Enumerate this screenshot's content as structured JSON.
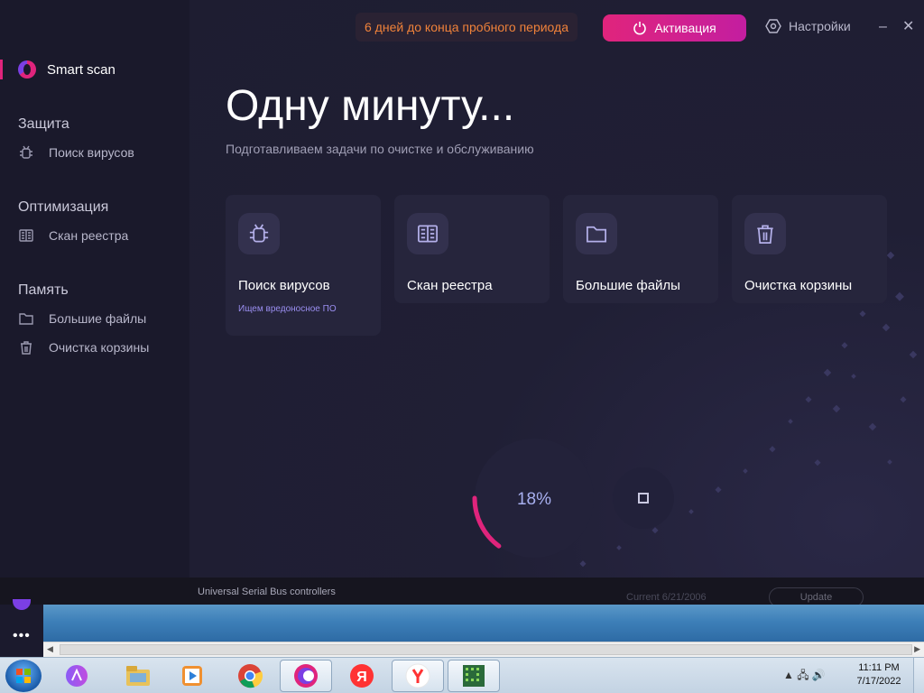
{
  "sidebar": {
    "smart_scan": "Smart scan",
    "groups": [
      {
        "title": "Защита",
        "items": [
          {
            "label": "Поиск вирусов",
            "icon": "bug-icon"
          }
        ]
      },
      {
        "title": "Оптимизация",
        "items": [
          {
            "label": "Скан реестра",
            "icon": "registry-icon"
          }
        ]
      },
      {
        "title": "Память",
        "items": [
          {
            "label": "Большие файлы",
            "icon": "folder-icon"
          },
          {
            "label": "Очистка корзины",
            "icon": "trash-icon"
          }
        ]
      }
    ]
  },
  "header": {
    "trial_text": "6 дней до конца пробного периода",
    "activate_label": "Активация",
    "settings_label": "Настройки",
    "minimize": "–",
    "close": "✕"
  },
  "main": {
    "title": "Одну минуту...",
    "subtitle": "Подготавливаем задачи по очистке и обслуживанию",
    "cards": [
      {
        "label": "Поиск вирусов",
        "sub": "Ищем вредоносное ПО",
        "icon": "bug-icon"
      },
      {
        "label": "Скан реестра",
        "sub": "",
        "icon": "registry-icon"
      },
      {
        "label": "Большие файлы",
        "sub": "",
        "icon": "folder-icon"
      },
      {
        "label": "Очистка корзины",
        "sub": "",
        "icon": "trash-icon"
      }
    ],
    "progress": {
      "percent_label": "18%",
      "value": 0.18
    }
  },
  "background_window": {
    "device_text": "Universal Serial Bus controllers",
    "current_text": "Current   6/21/2006",
    "update_label": "Update"
  },
  "left_dock": {
    "more": "•••"
  },
  "taskbar": {
    "apps": [
      "alice-icon",
      "explorer-icon",
      "media-player-icon",
      "chrome-icon",
      "cleaner-app-icon",
      "yandex-icon",
      "yandex-browser-icon",
      "grid-app-icon"
    ],
    "tray": "▲ 🖧 🔊",
    "time": "11:11 PM",
    "date": "7/17/2022"
  },
  "colors": {
    "accent": "#e0247c",
    "trial": "#f0823a",
    "bg": "#1d1c30"
  }
}
